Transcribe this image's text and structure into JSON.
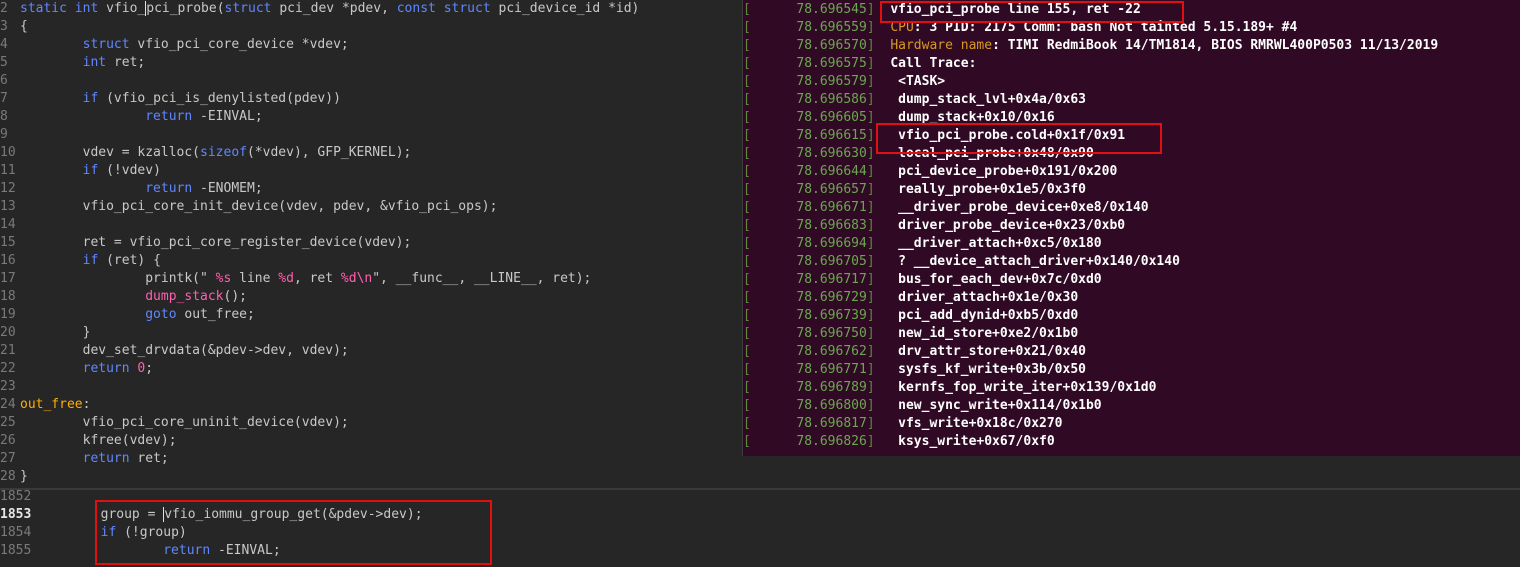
{
  "editor": {
    "lines": [
      {
        "n": "2",
        "code": [
          {
            "t": "static ",
            "c": "kw"
          },
          {
            "t": "int ",
            "c": "kw"
          },
          {
            "t": "vfio_"
          },
          {
            "t": "pci_probe("
          },
          {
            "t": "struct ",
            "c": "kw"
          },
          {
            "t": "pci_dev *pdev, "
          },
          {
            "t": "const ",
            "c": "kw"
          },
          {
            "t": "struct ",
            "c": "kw"
          },
          {
            "t": "pci_device_id *id)"
          }
        ]
      },
      {
        "n": "3",
        "code": [
          {
            "t": "{"
          }
        ]
      },
      {
        "n": "4",
        "code": [
          {
            "t": "        "
          },
          {
            "t": "struct ",
            "c": "kw"
          },
          {
            "t": "vfio_pci_core_device *vdev;"
          }
        ]
      },
      {
        "n": "5",
        "code": [
          {
            "t": "        "
          },
          {
            "t": "int ",
            "c": "kw"
          },
          {
            "t": "ret;"
          }
        ]
      },
      {
        "n": "6",
        "code": []
      },
      {
        "n": "7",
        "code": [
          {
            "t": "        "
          },
          {
            "t": "if ",
            "c": "kw"
          },
          {
            "t": "(vfio_pci_is_denylisted(pdev))"
          }
        ]
      },
      {
        "n": "8",
        "code": [
          {
            "t": "                "
          },
          {
            "t": "return ",
            "c": "kw"
          },
          {
            "t": "-EINVAL;"
          }
        ]
      },
      {
        "n": "9",
        "code": []
      },
      {
        "n": "10",
        "code": [
          {
            "t": "        vdev = kzalloc("
          },
          {
            "t": "sizeof",
            "c": "kw"
          },
          {
            "t": "(*vdev), GFP_KERNEL);"
          }
        ]
      },
      {
        "n": "11",
        "code": [
          {
            "t": "        "
          },
          {
            "t": "if ",
            "c": "kw"
          },
          {
            "t": "(!vdev)"
          }
        ]
      },
      {
        "n": "12",
        "code": [
          {
            "t": "                "
          },
          {
            "t": "return ",
            "c": "kw"
          },
          {
            "t": "-ENOMEM;"
          }
        ]
      },
      {
        "n": "13",
        "code": [
          {
            "t": "        vfio_pci_core_init_device(vdev, pdev, &vfio_pci_ops);"
          }
        ]
      },
      {
        "n": "14",
        "code": []
      },
      {
        "n": "15",
        "code": [
          {
            "t": "        ret = vfio_pci_core_register_device(vdev);"
          }
        ]
      },
      {
        "n": "16",
        "code": [
          {
            "t": "        "
          },
          {
            "t": "if ",
            "c": "kw"
          },
          {
            "t": "(ret) {"
          }
        ]
      },
      {
        "n": "17",
        "code": [
          {
            "t": "                printk(\" "
          },
          {
            "t": "%s",
            "c": "str"
          },
          {
            "t": " line "
          },
          {
            "t": "%d",
            "c": "str"
          },
          {
            "t": ", ret "
          },
          {
            "t": "%d\\n",
            "c": "str"
          },
          {
            "t": "\", __func__, __LINE__, ret);"
          }
        ]
      },
      {
        "n": "18",
        "code": [
          {
            "t": "                "
          },
          {
            "t": "dump_stack",
            "c": "fn"
          },
          {
            "t": "();"
          }
        ]
      },
      {
        "n": "19",
        "code": [
          {
            "t": "                "
          },
          {
            "t": "goto ",
            "c": "kw"
          },
          {
            "t": "out_free;"
          }
        ]
      },
      {
        "n": "20",
        "code": [
          {
            "t": "        }"
          }
        ]
      },
      {
        "n": "21",
        "code": [
          {
            "t": "        dev_set_drvdata(&pdev->dev, vdev);"
          }
        ]
      },
      {
        "n": "22",
        "code": [
          {
            "t": "        "
          },
          {
            "t": "return ",
            "c": "kw"
          },
          {
            "t": "0",
            "c": "str"
          },
          {
            "t": ";"
          }
        ]
      },
      {
        "n": "23",
        "code": []
      },
      {
        "n": "24",
        "code": [
          {
            "t": "out_free",
            "c": "lbl"
          },
          {
            "t": ":"
          }
        ]
      },
      {
        "n": "25",
        "code": [
          {
            "t": "        vfio_pci_core_uninit_device(vdev);"
          }
        ]
      },
      {
        "n": "26",
        "code": [
          {
            "t": "        kfree(vdev);"
          }
        ]
      },
      {
        "n": "27",
        "code": [
          {
            "t": "        "
          },
          {
            "t": "return ",
            "c": "kw"
          },
          {
            "t": "ret;"
          }
        ]
      },
      {
        "n": "28",
        "code": [
          {
            "t": "}"
          }
        ]
      }
    ],
    "bottom_lines": [
      {
        "n": "1852",
        "cur": false,
        "code": []
      },
      {
        "n": "1853",
        "cur": true,
        "code": [
          {
            "t": "        group = "
          },
          {
            "t": "vfio_iommu_group_get(&pdev->dev);"
          }
        ]
      },
      {
        "n": "1854",
        "cur": false,
        "code": [
          {
            "t": "        "
          },
          {
            "t": "if ",
            "c": "kw"
          },
          {
            "t": "(!group)"
          }
        ]
      },
      {
        "n": "1855",
        "cur": false,
        "code": [
          {
            "t": "                "
          },
          {
            "t": "return ",
            "c": "kw"
          },
          {
            "t": "-EINVAL;"
          }
        ]
      }
    ]
  },
  "terminal": {
    "lines": [
      {
        "ts": "78.696545",
        "msg": "vfio_pci_probe line 155, ret -22",
        "style": "tm"
      },
      {
        "ts": "78.696559",
        "prefix": "CPU",
        "msg": ": 3 PID: 2175 Comm: bash Not tainted 5.15.189+ #4",
        "style": "tm"
      },
      {
        "ts": "78.696570",
        "prefix": "Hardware name",
        "msg": ": TIMI RedmiBook 14/TM1814, BIOS RMRWL400P0503 11/13/2019",
        "style": "tm"
      },
      {
        "ts": "78.696575",
        "msg": "Call Trace:",
        "style": "tm"
      },
      {
        "ts": "78.696579",
        "msg": " <TASK>",
        "style": "tm"
      },
      {
        "ts": "78.696586",
        "msg": " dump_stack_lvl+0x4a/0x63",
        "style": "tm"
      },
      {
        "ts": "78.696605",
        "msg": " dump_stack+0x10/0x16",
        "style": "tm"
      },
      {
        "ts": "78.696615",
        "msg": " vfio_pci_probe.cold+0x1f/0x91",
        "style": "tm"
      },
      {
        "ts": "78.696630",
        "msg": " local_pci_probe+0x48/0x90",
        "style": "tm"
      },
      {
        "ts": "78.696644",
        "msg": " pci_device_probe+0x191/0x200",
        "style": "tm"
      },
      {
        "ts": "78.696657",
        "msg": " really_probe+0x1e5/0x3f0",
        "style": "tm"
      },
      {
        "ts": "78.696671",
        "msg": " __driver_probe_device+0xe8/0x140",
        "style": "tm"
      },
      {
        "ts": "78.696683",
        "msg": " driver_probe_device+0x23/0xb0",
        "style": "tm"
      },
      {
        "ts": "78.696694",
        "msg": " __driver_attach+0xc5/0x180",
        "style": "tm"
      },
      {
        "ts": "78.696705",
        "msg": " ? __device_attach_driver+0x140/0x140",
        "style": "tm"
      },
      {
        "ts": "78.696717",
        "msg": " bus_for_each_dev+0x7c/0xd0",
        "style": "tm"
      },
      {
        "ts": "78.696729",
        "msg": " driver_attach+0x1e/0x30",
        "style": "tm"
      },
      {
        "ts": "78.696739",
        "msg": " pci_add_dynid+0xb5/0xd0",
        "style": "tm"
      },
      {
        "ts": "78.696750",
        "msg": " new_id_store+0xe2/0x1b0",
        "style": "tm"
      },
      {
        "ts": "78.696762",
        "msg": " drv_attr_store+0x21/0x40",
        "style": "tm"
      },
      {
        "ts": "78.696771",
        "msg": " sysfs_kf_write+0x3b/0x50",
        "style": "tm"
      },
      {
        "ts": "78.696789",
        "msg": " kernfs_fop_write_iter+0x139/0x1d0",
        "style": "tm"
      },
      {
        "ts": "78.696800",
        "msg": " new_sync_write+0x114/0x1b0",
        "style": "tm"
      },
      {
        "ts": "78.696817",
        "msg": " vfs_write+0x18c/0x270",
        "style": "tm"
      },
      {
        "ts": "78.696826",
        "msg": " ksys_write+0x67/0xf0",
        "style": "tm"
      }
    ]
  },
  "colors": {
    "editor_bg": "#262626",
    "terminal_bg": "#300a24",
    "keyword": "#5f87ff",
    "string": "#ff5faf",
    "label": "#ffaf00",
    "highlight_box": "#e01010"
  }
}
